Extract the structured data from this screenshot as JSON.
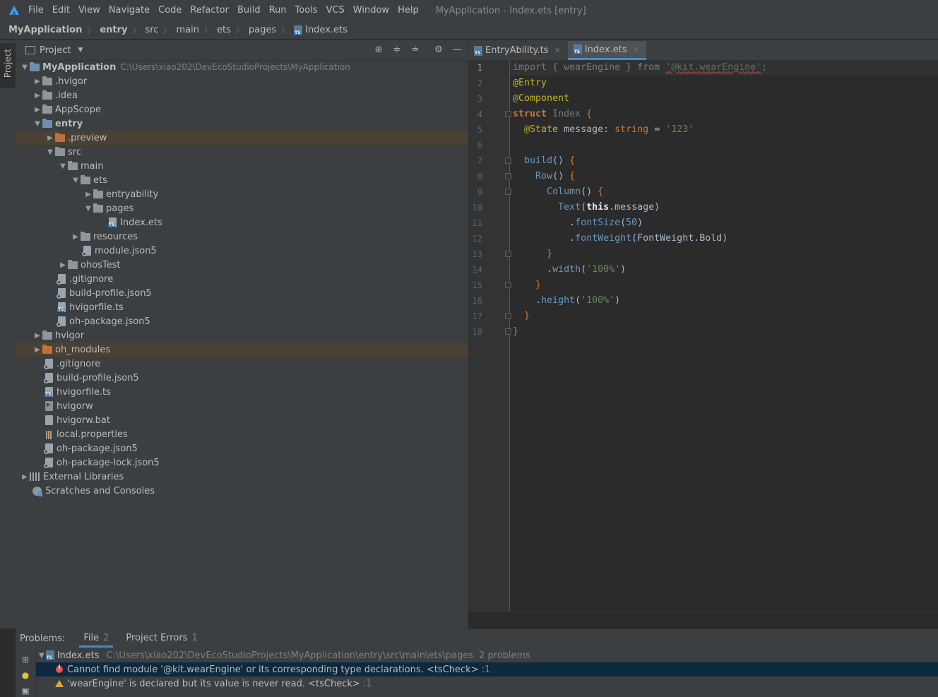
{
  "menubar": {
    "items": [
      "File",
      "Edit",
      "View",
      "Navigate",
      "Code",
      "Refactor",
      "Build",
      "Run",
      "Tools",
      "VCS",
      "Window",
      "Help"
    ],
    "window_title": "MyApplication - Index.ets [entry]"
  },
  "breadcrumbs": [
    "MyApplication",
    "entry",
    "src",
    "main",
    "ets",
    "pages",
    "Index.ets"
  ],
  "left_strip": {
    "tab": "Project"
  },
  "project_panel": {
    "title": "Project",
    "root": {
      "name": "MyApplication",
      "path": "C:\\Users\\xiao202\\DevEcoStudioProjects\\MyApplication"
    },
    "tree": [
      ".hvigor",
      ".idea",
      "AppScope",
      "entry",
      ".preview",
      "src",
      "main",
      "ets",
      "entryability",
      "pages",
      "Index.ets",
      "resources",
      "module.json5",
      "ohosTest",
      ".gitignore",
      "build-profile.json5",
      "hvigorfile.ts",
      "oh-package.json5",
      "hvigor",
      "oh_modules",
      ".gitignore",
      "build-profile.json5",
      "hvigorfile.ts",
      "hvigorw",
      "hvigorw.bat",
      "local.properties",
      "oh-package.json5",
      "oh-package-lock.json5",
      "External Libraries",
      "Scratches and Consoles"
    ]
  },
  "editor": {
    "tabs": [
      "EntryAbility.ts",
      "Index.ets"
    ],
    "active_tab": "Index.ets",
    "line_numbers": [
      "1",
      "2",
      "3",
      "4",
      "5",
      "6",
      "7",
      "8",
      "9",
      "10",
      "11",
      "12",
      "13",
      "14",
      "15",
      "16",
      "17",
      "18"
    ]
  },
  "problems": {
    "label": "Problems:",
    "tabs": [
      {
        "label": "File",
        "count": "2"
      },
      {
        "label": "Project Errors",
        "count": "1"
      }
    ],
    "file": {
      "name": "Index.ets",
      "path": "C:\\Users\\xiao202\\DevEcoStudioProjects\\MyApplication\\entry\\src\\main\\ets\\pages",
      "count": "2 problems"
    },
    "items": [
      {
        "severity": "error",
        "message": "Cannot find module '@kit.wearEngine' or its corresponding type declarations. <tsCheck>",
        "location": ":1"
      },
      {
        "severity": "warning",
        "message": "'wearEngine' is declared but its value is never read. <tsCheck>",
        "location": ":1"
      }
    ]
  },
  "colors": {
    "accent": "#4a88c7",
    "error": "#e0524c",
    "warning": "#e0a640",
    "highlight_row": "#4a4134"
  }
}
